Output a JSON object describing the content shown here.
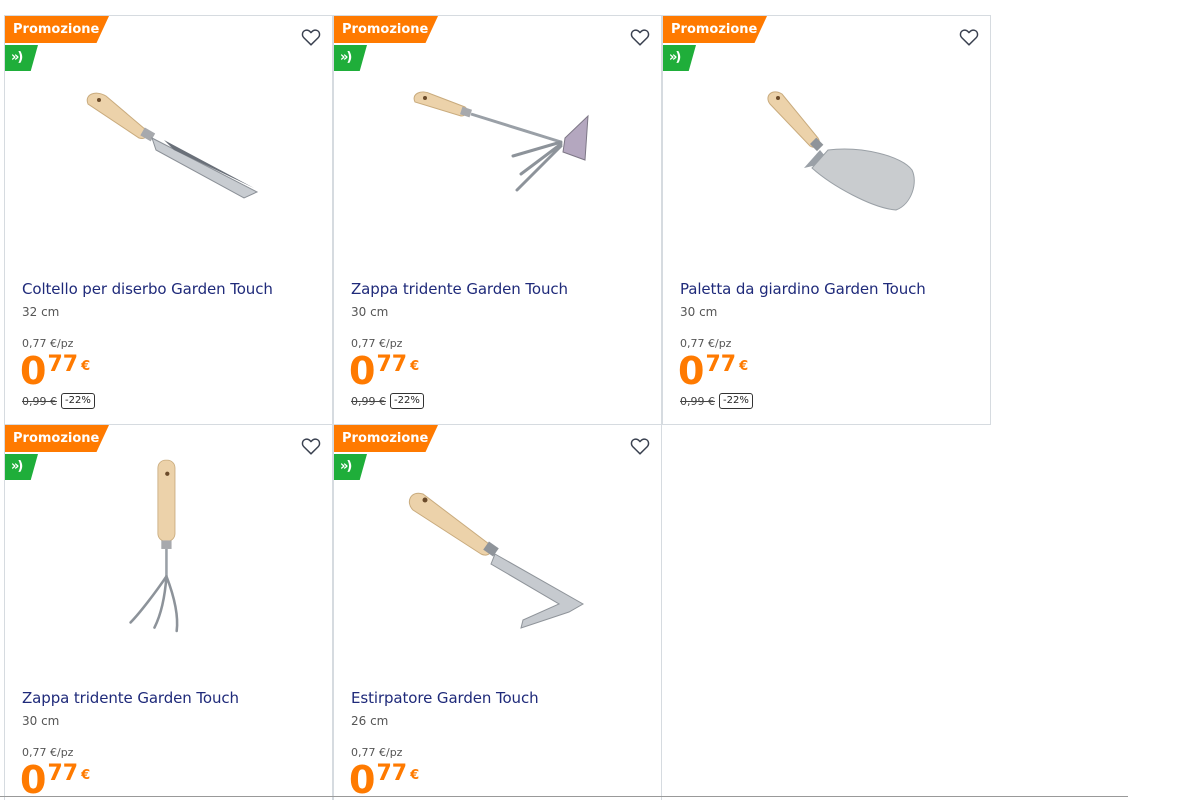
{
  "promo_label": "Promozione",
  "flag_glyph": "»)",
  "colors": {
    "accent": "#ff7a00",
    "flag": "#1fae3a",
    "title": "#1f2a7a"
  },
  "products": [
    {
      "title": "Coltello per diserbo Garden Touch",
      "size": "32 cm",
      "unit_price": "0,77 €/pz",
      "price_int": "0",
      "price_dec": "77",
      "currency": "€",
      "old_price": "0,99 €",
      "discount": "-22%",
      "icon": "weeding-knife-image"
    },
    {
      "title": "Zappa tridente Garden Touch",
      "size": "30 cm",
      "unit_price": "0,77 €/pz",
      "price_int": "0",
      "price_dec": "77",
      "currency": "€",
      "old_price": "0,99 €",
      "discount": "-22%",
      "icon": "hoe-fork-image"
    },
    {
      "title": "Paletta da giardino Garden Touch",
      "size": "30 cm",
      "unit_price": "0,77 €/pz",
      "price_int": "0",
      "price_dec": "77",
      "currency": "€",
      "old_price": "0,99 €",
      "discount": "-22%",
      "icon": "trowel-image"
    },
    {
      "title": "Zappa tridente Garden Touch",
      "size": "30 cm",
      "unit_price": "0,77 €/pz",
      "price_int": "0",
      "price_dec": "77",
      "currency": "€",
      "icon": "hand-cultivator-image"
    },
    {
      "title": "Estirpatore Garden Touch",
      "size": "26 cm",
      "unit_price": "0,77 €/pz",
      "price_int": "0",
      "price_dec": "77",
      "currency": "€",
      "icon": "weeder-image"
    }
  ]
}
